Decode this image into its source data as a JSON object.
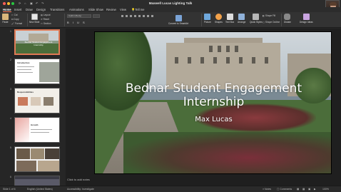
{
  "window": {
    "title": "Maxwell Lucas Lighting Talk"
  },
  "ribbon_tabs": [
    "Home",
    "Insert",
    "Draw",
    "Design",
    "Transitions",
    "Animations",
    "Slide Show",
    "Review",
    "View"
  ],
  "ribbon_tell": "Tell me",
  "ribbon": {
    "paste": "Paste",
    "cut": "Cut",
    "copy": "Copy",
    "format": "Format",
    "new_slide": "New Slide",
    "layout": "Layout",
    "reset": "Reset",
    "section": "Section",
    "font_name": "Calibri (Body)",
    "convert_smartart": "Convert to SmartArt",
    "picture": "Picture",
    "shapes": "Shapes",
    "text_box": "Text Box",
    "arrange": "Arrange",
    "quick_styles": "Quick Styles",
    "shape_fill": "Shape Fill",
    "shape_outline": "Shape Outline",
    "dictation": "Dictate",
    "design_ideas": "Design Ideas"
  },
  "thumbnails": [
    {
      "num": "1",
      "title": "Bednar Student Engagement Internship",
      "selected": true
    },
    {
      "num": "2",
      "title": "Introduction"
    },
    {
      "num": "3",
      "title": "Responsibilities"
    },
    {
      "num": "4",
      "title": "Growth"
    },
    {
      "num": "5",
      "title": ""
    },
    {
      "num": "6",
      "title": ""
    }
  ],
  "slide": {
    "title": "Bednar Student Engagement Internship",
    "subtitle": "Max Lucas"
  },
  "notes_placeholder": "Click to add notes",
  "status": {
    "slide_of": "Slide 1 of 6",
    "language": "English (United States)",
    "accessibility": "Accessibility: Investigate",
    "notes": "Notes",
    "comments": "Comments",
    "zoom": "100%"
  }
}
